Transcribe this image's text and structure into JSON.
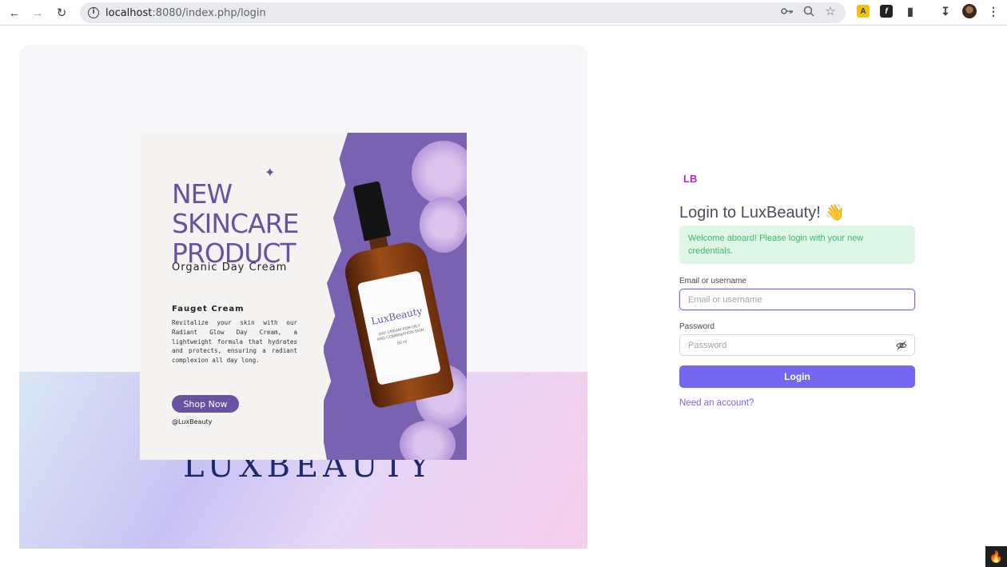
{
  "browser": {
    "url_host": "localhost",
    "url_rest": ":8080/index.php/login",
    "icons": [
      "back-icon",
      "forward-icon",
      "reload-icon",
      "info-icon",
      "key-icon",
      "zoom-icon",
      "star-icon",
      "extension-icon",
      "download-icon",
      "menu-icon"
    ]
  },
  "hero": {
    "watermark": "LUXBEAUTY",
    "poster": {
      "title_lines": [
        "NEW",
        "SKINCARE",
        "PRODUCT"
      ],
      "subtitle": "Organic Day Cream",
      "heading": "Fauget Cream",
      "body": "Revitalize your skin with our Radiant Glow Day Cream, a lightweight formula that hydrates and protects, ensuring a radiant complexion all day long.",
      "cta": "Shop Now",
      "handle": "@LuxBeauty",
      "bottle_brand": "LuxBeauty",
      "bottle_sub": "DAY CREAM FOR OILY AND COMBINATION SKIN",
      "bottle_size": "50 ml"
    }
  },
  "login": {
    "logo": "LB",
    "title": "Login to LuxBeauty! 👋",
    "alert": "Welcome aboard! Please login with your new credentials.",
    "email_label": "Email or username",
    "email_placeholder": "Email or username",
    "password_label": "Password",
    "password_placeholder": "Password",
    "submit": "Login",
    "signup_link": "Need an account?"
  },
  "colors": {
    "accent": "#7367f0",
    "logo": "#b226c9",
    "poster_purple": "#6a52a3",
    "alert_bg": "#def6e6",
    "alert_text": "#3cb96a"
  }
}
